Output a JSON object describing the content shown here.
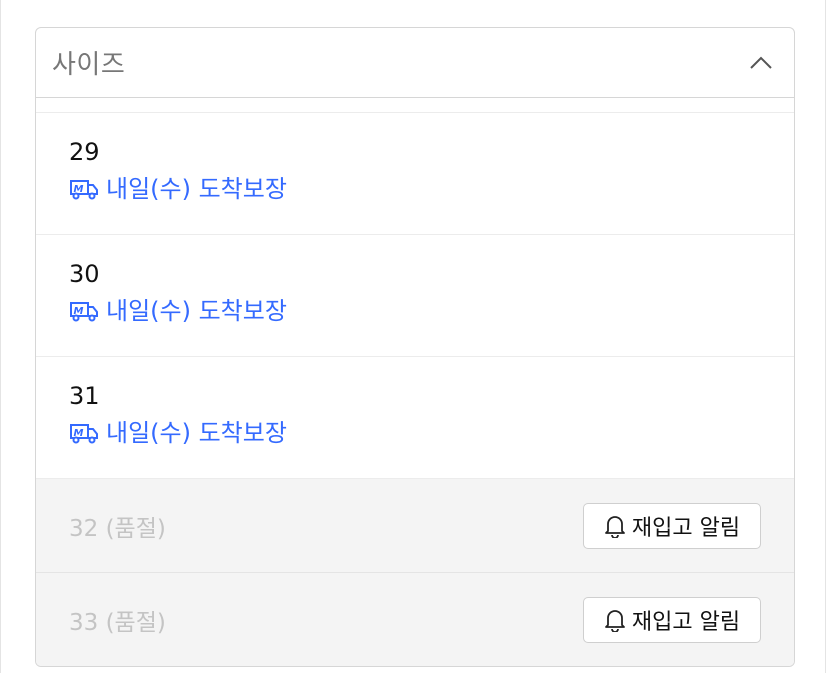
{
  "dropdown": {
    "label": "사이즈",
    "options": [
      {
        "size": "29",
        "delivery": "내일(수) 도착보장"
      },
      {
        "size": "30",
        "delivery": "내일(수) 도착보장"
      },
      {
        "size": "31",
        "delivery": "내일(수) 도착보장"
      }
    ],
    "soldout": [
      {
        "size": "32 (품절)",
        "button": "재입고 알림"
      },
      {
        "size": "33 (품절)",
        "button": "재입고 알림"
      }
    ]
  },
  "colors": {
    "delivery_blue": "#346aff",
    "soldout_text": "#c4c4c4",
    "soldout_bg": "#f4f4f4"
  },
  "icons": {
    "header": "chevron-up-icon",
    "delivery": "delivery-truck-icon",
    "notify": "bell-icon"
  }
}
